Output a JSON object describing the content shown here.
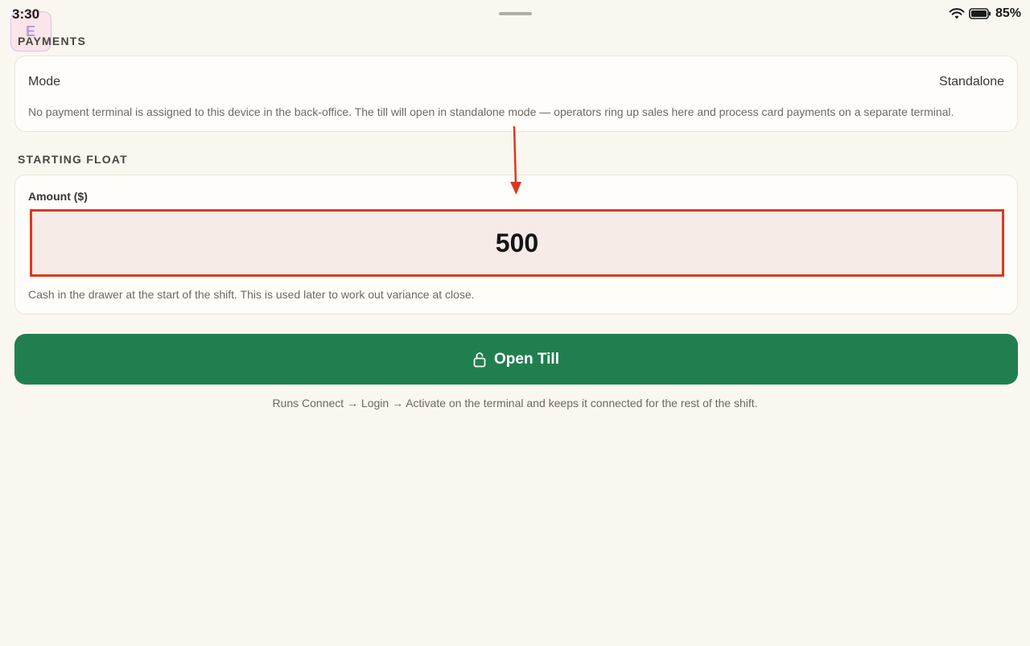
{
  "status_bar": {
    "time": "3:30",
    "battery": "85%",
    "wifi_icon": "wifi-icon",
    "battery_icon": "battery-icon"
  },
  "app_badge": {
    "letter": "E"
  },
  "payments": {
    "section_title": "PAYMENTS",
    "mode_label": "Mode",
    "mode_value": "Standalone",
    "description": "No payment terminal is assigned to this device in the back-office. The till will open in standalone mode — operators ring up sales here and process card payments on a separate terminal."
  },
  "starting_float": {
    "section_title": "STARTING FLOAT",
    "amount_label": "Amount ($)",
    "amount_value": "500",
    "description": "Cash in the drawer at the start of the shift. This is used later to work out variance at close."
  },
  "open_button": {
    "label": "Open Till",
    "icon": "unlock-icon",
    "color": "#217f4f"
  },
  "footer_note": "Runs Connect → Login → Activate on the terminal and keeps it connected for the rest of the shift.",
  "annotation": {
    "color": "#d93a1f"
  }
}
